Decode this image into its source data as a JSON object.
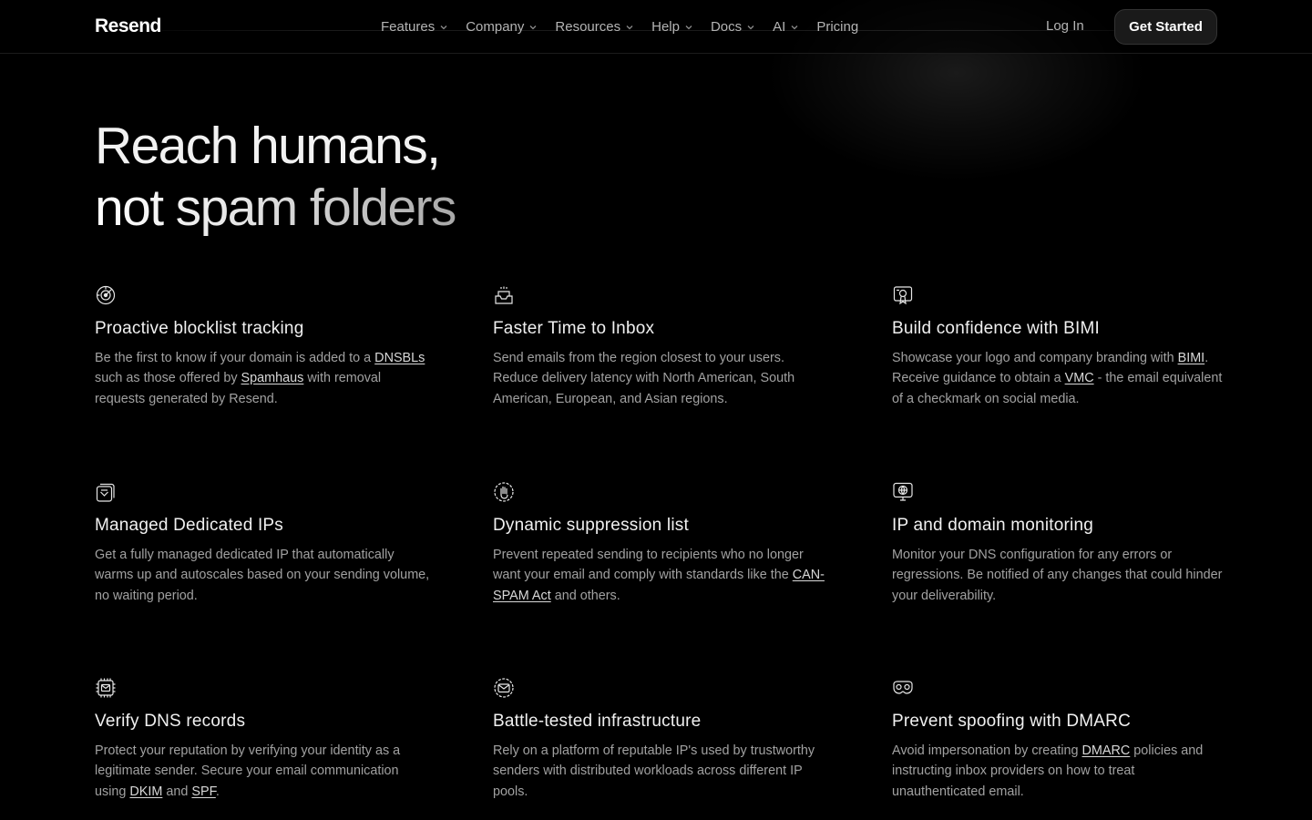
{
  "brand": {
    "logo": "Resend"
  },
  "nav": {
    "items": [
      {
        "label": "Features",
        "dropdown": true
      },
      {
        "label": "Company",
        "dropdown": true
      },
      {
        "label": "Resources",
        "dropdown": true
      },
      {
        "label": "Help",
        "dropdown": true
      },
      {
        "label": "Docs",
        "dropdown": true
      },
      {
        "label": "AI",
        "dropdown": true
      },
      {
        "label": "Pricing",
        "dropdown": false
      }
    ],
    "login": "Log In",
    "cta": "Get Started"
  },
  "hero": {
    "line1": "Reach humans,",
    "line2": "not spam folders"
  },
  "features": [
    {
      "icon": "blocklist-radar-icon",
      "title": "Proactive blocklist tracking",
      "parts": [
        {
          "text": "Be the first to know if your domain is added to a "
        },
        {
          "text": "DNSBLs",
          "link": true
        },
        {
          "text": " such as those offered by "
        },
        {
          "text": "Spamhaus",
          "link": true
        },
        {
          "text": " with removal requests generated by Resend."
        }
      ]
    },
    {
      "icon": "inbox-tray-icon",
      "title": "Faster Time to Inbox",
      "parts": [
        {
          "text": "Send emails from the region closest to your users. Reduce delivery latency with North American, South American, European, and Asian regions."
        }
      ]
    },
    {
      "icon": "bimi-badge-icon",
      "title": "Build confidence with BIMI",
      "parts": [
        {
          "text": "Showcase your logo and company branding with "
        },
        {
          "text": "BIMI",
          "link": true
        },
        {
          "text": ". Receive guidance to obtain a "
        },
        {
          "text": "VMC",
          "link": true
        },
        {
          "text": " - the email equivalent of a checkmark on social media."
        }
      ]
    },
    {
      "icon": "dedicated-ip-stack-icon",
      "title": "Managed Dedicated IPs",
      "parts": [
        {
          "text": "Get a fully managed dedicated IP that automatically warms up and autoscales based on your sending volume, no waiting period."
        }
      ]
    },
    {
      "icon": "hand-stop-icon",
      "title": "Dynamic suppression list",
      "parts": [
        {
          "text": "Prevent repeated sending to recipients who no longer want your email and comply with standards like the "
        },
        {
          "text": "CAN-SPAM Act",
          "link": true
        },
        {
          "text": " and others."
        }
      ]
    },
    {
      "icon": "globe-monitor-icon",
      "title": "IP and domain monitoring",
      "parts": [
        {
          "text": "Monitor your DNS configuration for any errors or regressions. Be notified of any changes that could hinder your deliverability."
        }
      ]
    },
    {
      "icon": "chip-envelope-icon",
      "title": "Verify DNS records",
      "parts": [
        {
          "text": "Protect your reputation by verifying your identity as a legitimate sender. Secure your email communication using "
        },
        {
          "text": "DKIM",
          "link": true
        },
        {
          "text": " and "
        },
        {
          "text": "SPF",
          "link": true
        },
        {
          "text": "."
        }
      ]
    },
    {
      "icon": "shield-envelope-icon",
      "title": "Battle-tested infrastructure",
      "parts": [
        {
          "text": "Rely on a platform of reputable IP's used by trustworthy senders with distributed workloads across different IP pools."
        }
      ]
    },
    {
      "icon": "mask-icon",
      "title": "Prevent spoofing with DMARC",
      "parts": [
        {
          "text": "Avoid impersonation by creating "
        },
        {
          "text": "DMARC",
          "link": true
        },
        {
          "text": " policies and instructing inbox providers on how to treat unauthenticated email."
        }
      ]
    }
  ]
}
